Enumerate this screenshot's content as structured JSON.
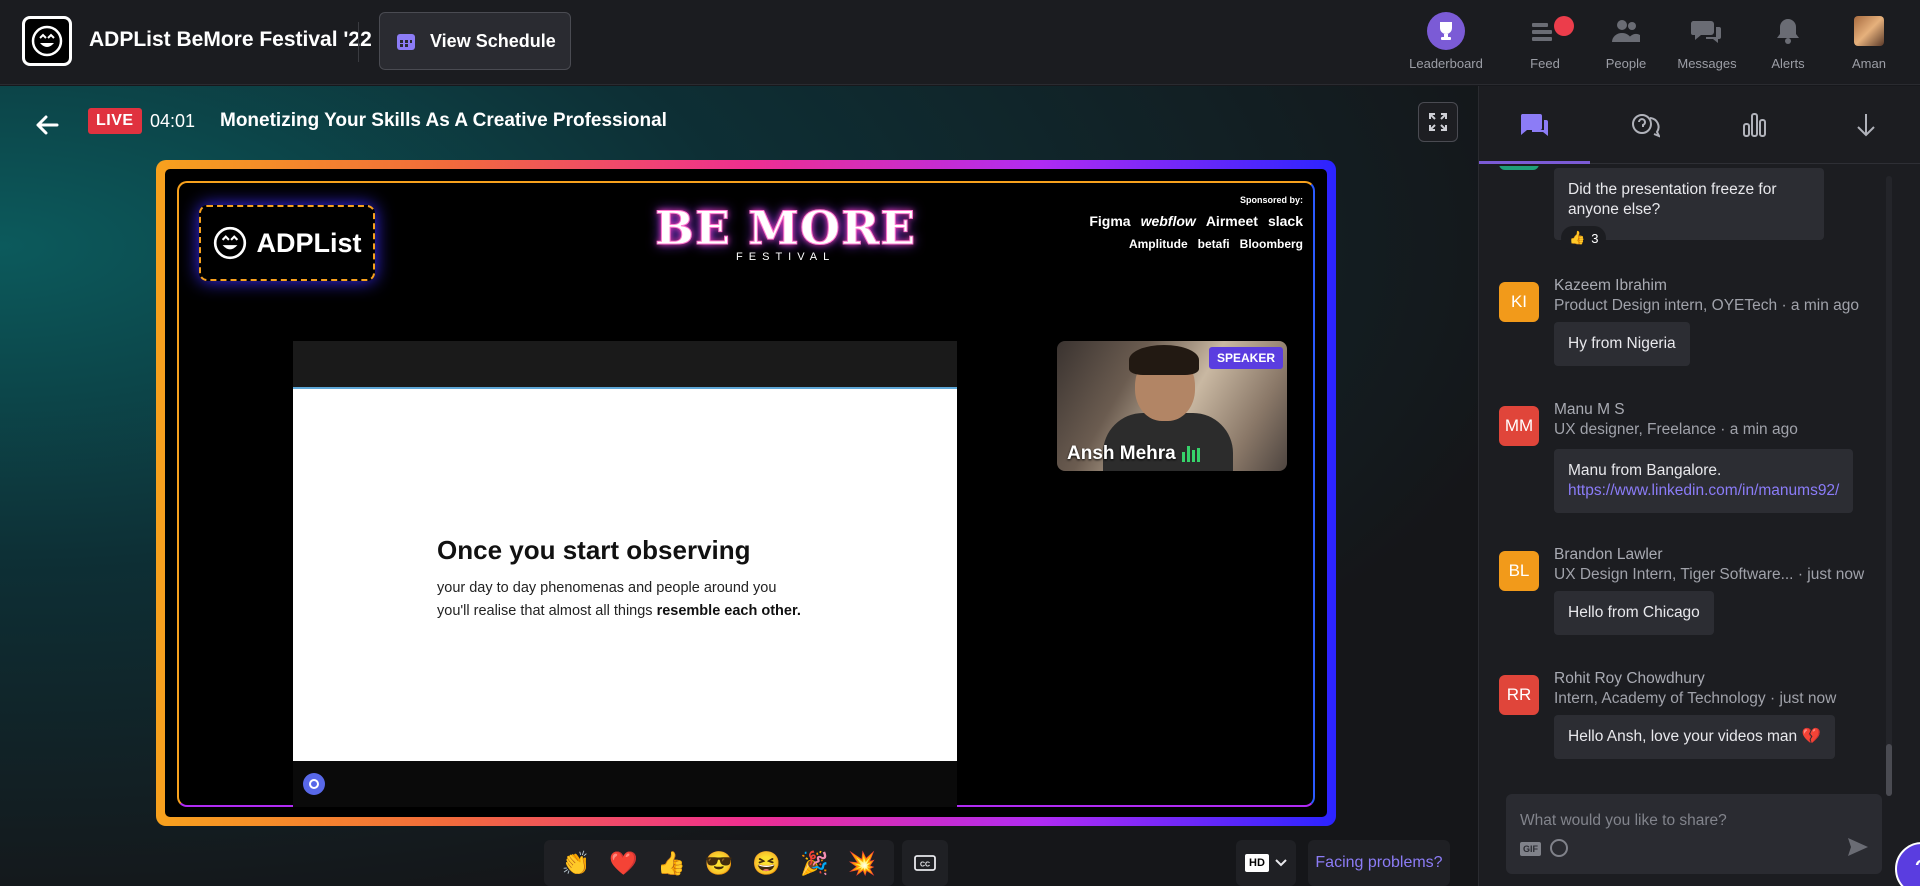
{
  "header": {
    "event_title": "ADPList BeMore Festival '22",
    "schedule_label": "View Schedule",
    "nav": [
      {
        "label": "Leaderboard",
        "icon": "trophy-icon"
      },
      {
        "label": "Feed",
        "icon": "feed-icon"
      },
      {
        "label": "People",
        "icon": "people-icon"
      },
      {
        "label": "Messages",
        "icon": "messages-icon"
      },
      {
        "label": "Alerts",
        "icon": "bell-icon"
      },
      {
        "label": "Aman",
        "icon": "avatar"
      }
    ]
  },
  "session": {
    "live_label": "LIVE",
    "timer": "04:01",
    "title": "Monetizing Your Skills As A Creative Professional"
  },
  "stage": {
    "brand": "ADPList",
    "festival_big": "BE MORE",
    "festival_small": "FESTIVAL",
    "sponsored_by": "Sponsored by:",
    "sponsors_row1": [
      "Figma",
      "webflow",
      "Airmeet",
      "slack"
    ],
    "sponsors_row2": [
      "Amplitude",
      "betafi",
      "Bloomberg"
    ],
    "slide_title": "Once you start observing",
    "slide_line1": "your day to day phenomenas and people around you",
    "slide_line2_plain": "you'll realise that almost all things ",
    "slide_line2_bold": "resemble each other.",
    "speaker_badge": "SPEAKER",
    "speaker_name": "Ansh Mehra"
  },
  "controls": {
    "reactions": [
      "👏",
      "❤️",
      "👍",
      "😎",
      "😆",
      "🎉",
      "💥"
    ],
    "cc_label": "CC",
    "hd_label": "HD",
    "problems_label": "Facing problems?"
  },
  "chat": {
    "tabs": [
      "chat-icon",
      "qa-icon",
      "poll-icon",
      "download-icon"
    ],
    "messages": [
      {
        "initials": "",
        "color": "#1fa07a",
        "name": "",
        "role": "",
        "time": "",
        "text": "Did the presentation freeze for anyone else?",
        "reaction": "👍",
        "reaction_count": "3"
      },
      {
        "initials": "KI",
        "color": "#f29a1a",
        "name": "Kazeem Ibrahim",
        "role": "Product Design intern, OYETech",
        "time": "· a min ago",
        "text": "Hy from Nigeria"
      },
      {
        "initials": "MM",
        "color": "#e0453a",
        "name": "Manu M S",
        "role": "UX designer, Freelance",
        "time": "· a min ago",
        "text": "Manu from Bangalore.",
        "link": "https://www.linkedin.com/in/manums92/"
      },
      {
        "initials": "BL",
        "color": "#f29a1a",
        "name": "Brandon Lawler",
        "role": "UX Design Intern, Tiger Software...",
        "time": "· just now",
        "text": "Hello from Chicago"
      },
      {
        "initials": "RR",
        "color": "#e0453a",
        "name": "Rohit Roy Chowdhury",
        "role": "Intern, Academy of Technology",
        "time": "· just now",
        "text": "Hello Ansh, love your videos man 💔"
      }
    ],
    "composer_placeholder": "What would you like to share?",
    "gif_label": "GIF",
    "help_label": "?"
  }
}
